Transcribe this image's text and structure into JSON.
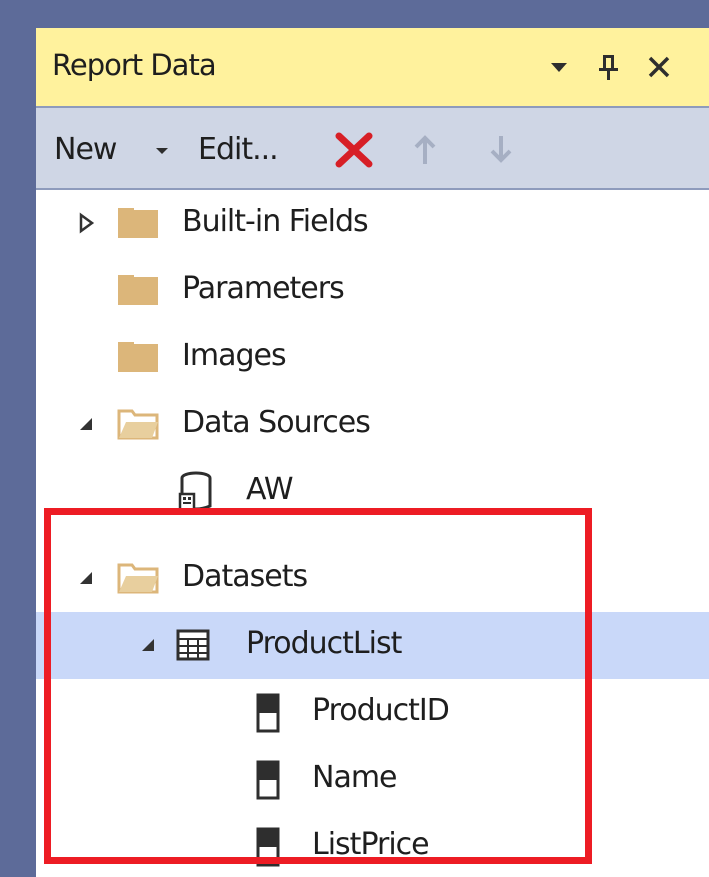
{
  "window": {
    "title": "Report Data",
    "buttons": {
      "dropdown": "dropdown-arrow-icon",
      "pin": "pin-icon",
      "close": "close-icon"
    }
  },
  "toolbar": {
    "new_label": "New",
    "edit_label": "Edit...",
    "delete_icon": "delete-red-x-icon",
    "move_up_icon": "arrow-up-icon",
    "move_down_icon": "arrow-down-icon"
  },
  "tree": {
    "items": [
      {
        "label": "Built-in Fields",
        "state": "collapsed",
        "icon": "folder-closed-icon"
      },
      {
        "label": "Parameters",
        "icon": "folder-closed-icon"
      },
      {
        "label": "Images",
        "icon": "folder-closed-icon"
      },
      {
        "label": "Data Sources",
        "state": "expanded",
        "icon": "folder-open-icon"
      },
      {
        "label": "AW",
        "icon": "database-icon"
      },
      {
        "label": "Datasets",
        "state": "expanded",
        "icon": "folder-open-icon"
      },
      {
        "label": "ProductList",
        "state": "expanded",
        "selected": true,
        "icon": "dataset-table-icon"
      },
      {
        "label": "ProductID",
        "icon": "field-icon"
      },
      {
        "label": "Name",
        "icon": "field-icon"
      },
      {
        "label": "ListPrice",
        "icon": "field-icon"
      }
    ]
  },
  "colors": {
    "title_bar": "#fff29d",
    "toolbar": "#cfd6e5",
    "selection": "#c9d8f9",
    "highlight_box": "#ed1c24",
    "folder": "#dcb67a"
  }
}
